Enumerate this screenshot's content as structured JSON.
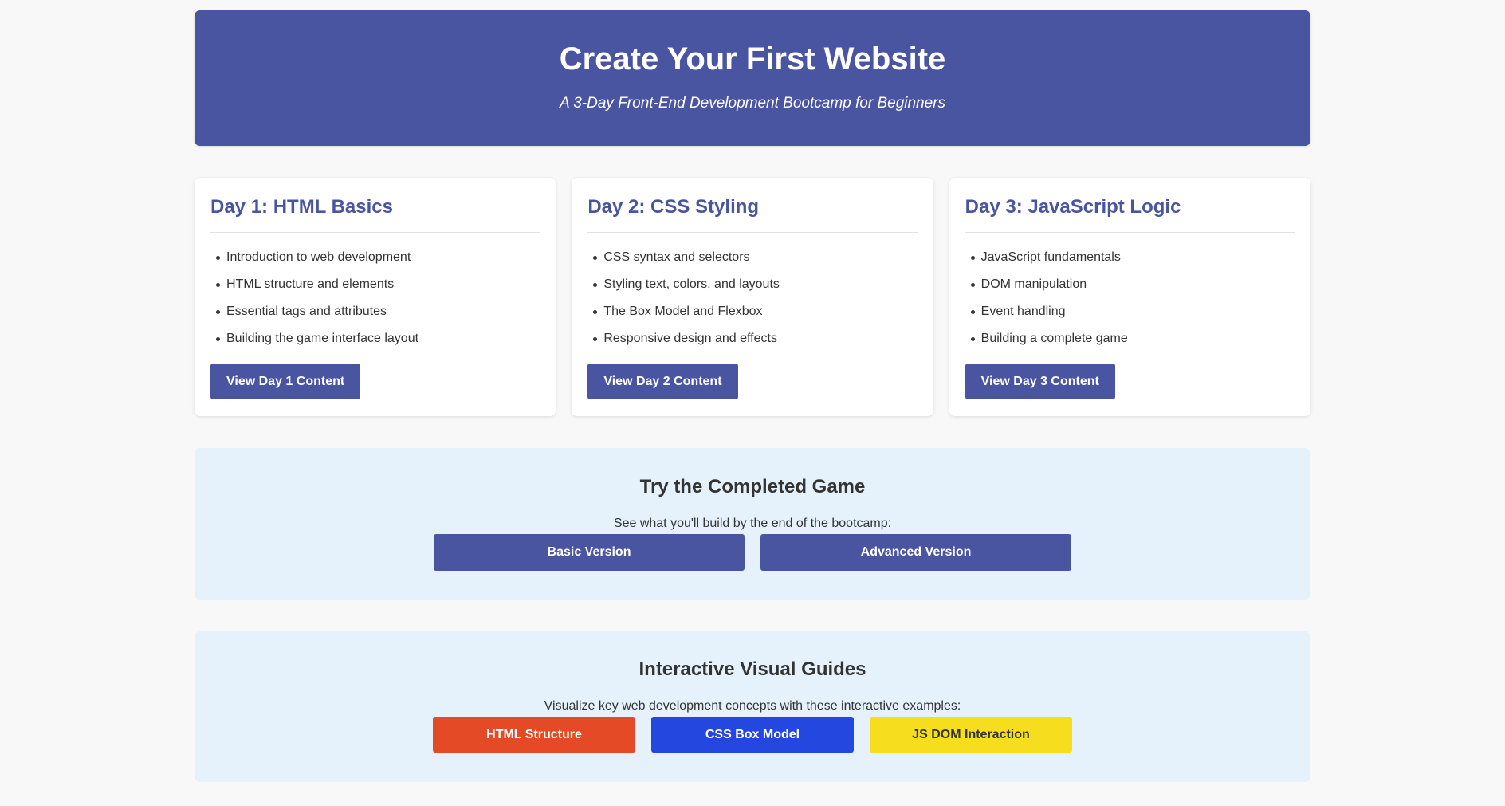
{
  "hero": {
    "title": "Create Your First Website",
    "subtitle": "A 3-Day Front-End Development Bootcamp for Beginners"
  },
  "days": [
    {
      "title": "Day 1: HTML Basics",
      "items": [
        "Introduction to web development",
        "HTML structure and elements",
        "Essential tags and attributes",
        "Building the game interface layout"
      ],
      "button": "View Day 1 Content"
    },
    {
      "title": "Day 2: CSS Styling",
      "items": [
        "CSS syntax and selectors",
        "Styling text, colors, and layouts",
        "The Box Model and Flexbox",
        "Responsive design and effects"
      ],
      "button": "View Day 2 Content"
    },
    {
      "title": "Day 3: JavaScript Logic",
      "items": [
        "JavaScript fundamentals",
        "DOM manipulation",
        "Event handling",
        "Building a complete game"
      ],
      "button": "View Day 3 Content"
    }
  ],
  "game": {
    "title": "Try the Completed Game",
    "description": "See what you'll build by the end of the bootcamp:",
    "basic_button": "Basic Version",
    "advanced_button": "Advanced Version"
  },
  "guides": {
    "title": "Interactive Visual Guides",
    "description": "Visualize key web development concepts with these interactive examples:",
    "buttons": [
      {
        "label": "HTML Structure",
        "color": "#e34a25"
      },
      {
        "label": "CSS Box Model",
        "color": "#2347df"
      },
      {
        "label": "JS DOM Interaction",
        "color": "#f6de1f"
      }
    ]
  },
  "colors": {
    "primary": "#4a55a2",
    "page_background": "#f8f8f8",
    "section_background": "#e5f2fc"
  }
}
